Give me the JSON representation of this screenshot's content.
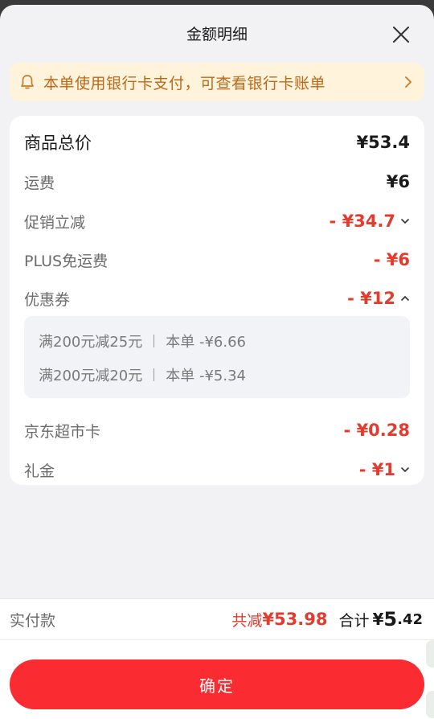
{
  "dialog": {
    "title": "金额明细"
  },
  "notice": {
    "text": "本单使用银行卡支付，可查看银行卡账单"
  },
  "summary": {
    "goods_total": {
      "label": "商品总价",
      "value": "¥53.4"
    },
    "rows": [
      {
        "label": "运费",
        "value": "¥6"
      },
      {
        "label": "促销立减",
        "value": "- ¥34.7"
      },
      {
        "label": "PLUS免运费",
        "value": "- ¥6"
      },
      {
        "label": "优惠券",
        "value": "- ¥12"
      },
      {
        "label": "京东超市卡",
        "value": "- ¥0.28"
      },
      {
        "label": "礼金",
        "value": "- ¥1"
      }
    ],
    "coupons": [
      {
        "name": "满200元减25元",
        "detail": "本单 -¥6.66"
      },
      {
        "name": "满200元减20元",
        "detail": "本单 -¥5.34"
      }
    ]
  },
  "footer": {
    "paid_label": "实付款",
    "saved_prefix": "共减",
    "saved_value": "¥53.98",
    "total_prefix": "合计",
    "total_yen": "¥",
    "total_int": "5",
    "total_dec": ".42",
    "confirm_label": "确定"
  },
  "colors": {
    "accent_red": "#fa2b31",
    "discount_red": "#e33b2e",
    "notice_bg": "#fff3dc",
    "notice_text": "#b96a1a"
  }
}
